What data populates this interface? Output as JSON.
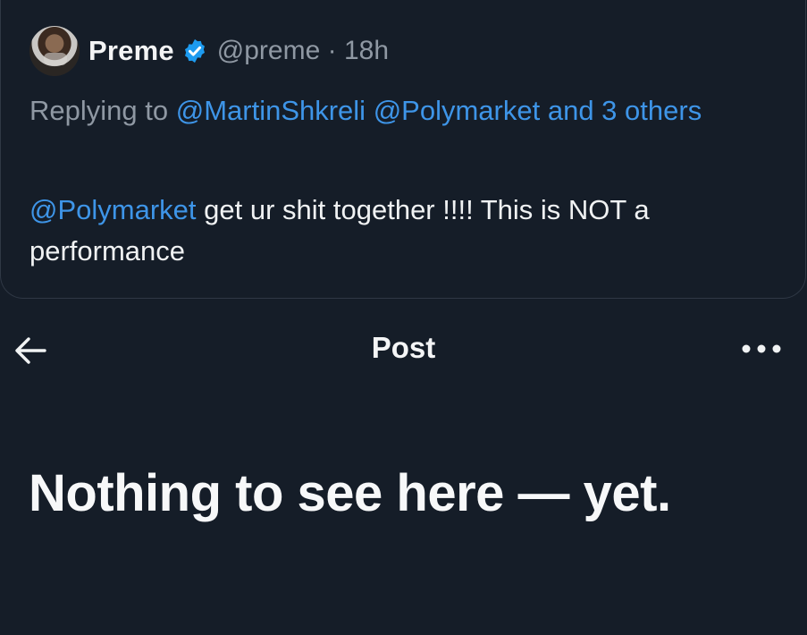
{
  "quoted_post": {
    "author": {
      "display_name": "Preme",
      "handle": "@preme",
      "separator": "·",
      "time": "18h",
      "verified_icon": "verified-badge-icon",
      "verified_color": "#1d9bf0"
    },
    "replying": {
      "prefix": "Replying to",
      "mention_1": "@MartinShkreli",
      "mention_2": "@Polymarket",
      "suffix": "and 3 others"
    },
    "body": {
      "mention": "@Polymarket",
      "text": "get ur shit together !!!! This is NOT a performance"
    }
  },
  "top_bar": {
    "back_icon": "back-arrow-icon",
    "title": "Post",
    "more_icon": "more-options-icon"
  },
  "empty_state": {
    "headline": "Nothing to see here — yet."
  },
  "colors": {
    "background": "#151d28",
    "link": "#3e95e8",
    "muted": "#8f98a3",
    "text": "#f0f2f3"
  }
}
